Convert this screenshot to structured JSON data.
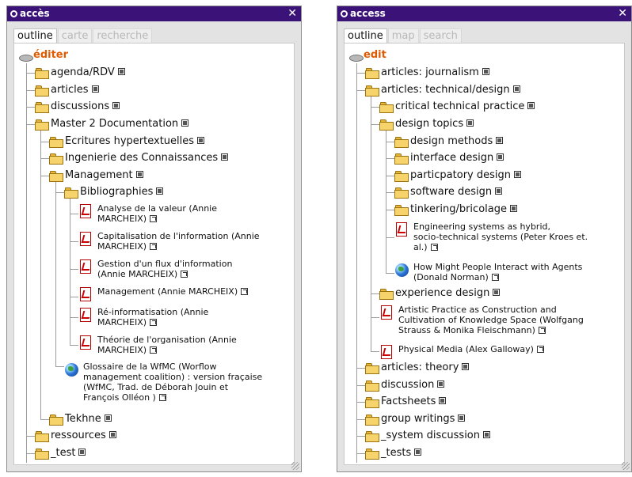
{
  "left": {
    "title": "accès",
    "tabs": [
      "outline",
      "carte",
      "recherche"
    ],
    "root": "éditer",
    "items": [
      {
        "label": "agenda/RDV"
      },
      {
        "label": "articles"
      },
      {
        "label": "discussions"
      },
      {
        "label": "Master 2 Documentation"
      },
      {
        "label": "Ecritures hypertextuelles"
      },
      {
        "label": "Ingenierie des Connaissances"
      },
      {
        "label": "Management"
      },
      {
        "label": "Bibliographies"
      },
      {
        "label": "Analyse de la valeur (Annie\nMARCHEIX)"
      },
      {
        "label": "Capitalisation de l'information (Annie\nMARCHEIX)"
      },
      {
        "label": "Gestion d'un flux d'information\n(Annie MARCHEIX)"
      },
      {
        "label": "Management (Annie MARCHEIX)"
      },
      {
        "label": "Ré-informatisation (Annie\nMARCHEIX)"
      },
      {
        "label": "Théorie de l'organisation (Annie\nMARCHEIX)"
      },
      {
        "label": "Glossaire de la WfMC (Worflow\nmanagement coalition) : version fraçaise\n(WfMC, Trad. de Déborah Jouin et\nFrançois Olléon )"
      },
      {
        "label": "Tekhne"
      },
      {
        "label": "ressources"
      },
      {
        "label": "_test"
      }
    ]
  },
  "right": {
    "title": "access",
    "tabs": [
      "outline",
      "map",
      "search"
    ],
    "root": "edit",
    "items": [
      {
        "label": "articles: journalism"
      },
      {
        "label": "articles: technical/design"
      },
      {
        "label": "critical technical practice"
      },
      {
        "label": "design topics"
      },
      {
        "label": "design methods"
      },
      {
        "label": "interface design"
      },
      {
        "label": "particpatory design"
      },
      {
        "label": "software design"
      },
      {
        "label": "tinkering/bricolage"
      },
      {
        "label": "Engineering systems as hybrid,\nsocio-technical systems (Peter Kroes et.\nal.)"
      },
      {
        "label": "How Might People Interact with Agents\n(Donald Norman)"
      },
      {
        "label": "experience design"
      },
      {
        "label": "Artistic Practice as Construction and\nCultivation of Knowledge Space (Wolfgang\nStrauss & Monika Fleischmann)"
      },
      {
        "label": "Physical Media (Alex Galloway)"
      },
      {
        "label": "articles: theory"
      },
      {
        "label": "discussion"
      },
      {
        "label": "Factsheets"
      },
      {
        "label": "group writings"
      },
      {
        "label": "_system discussion"
      },
      {
        "label": "_tests"
      }
    ]
  }
}
